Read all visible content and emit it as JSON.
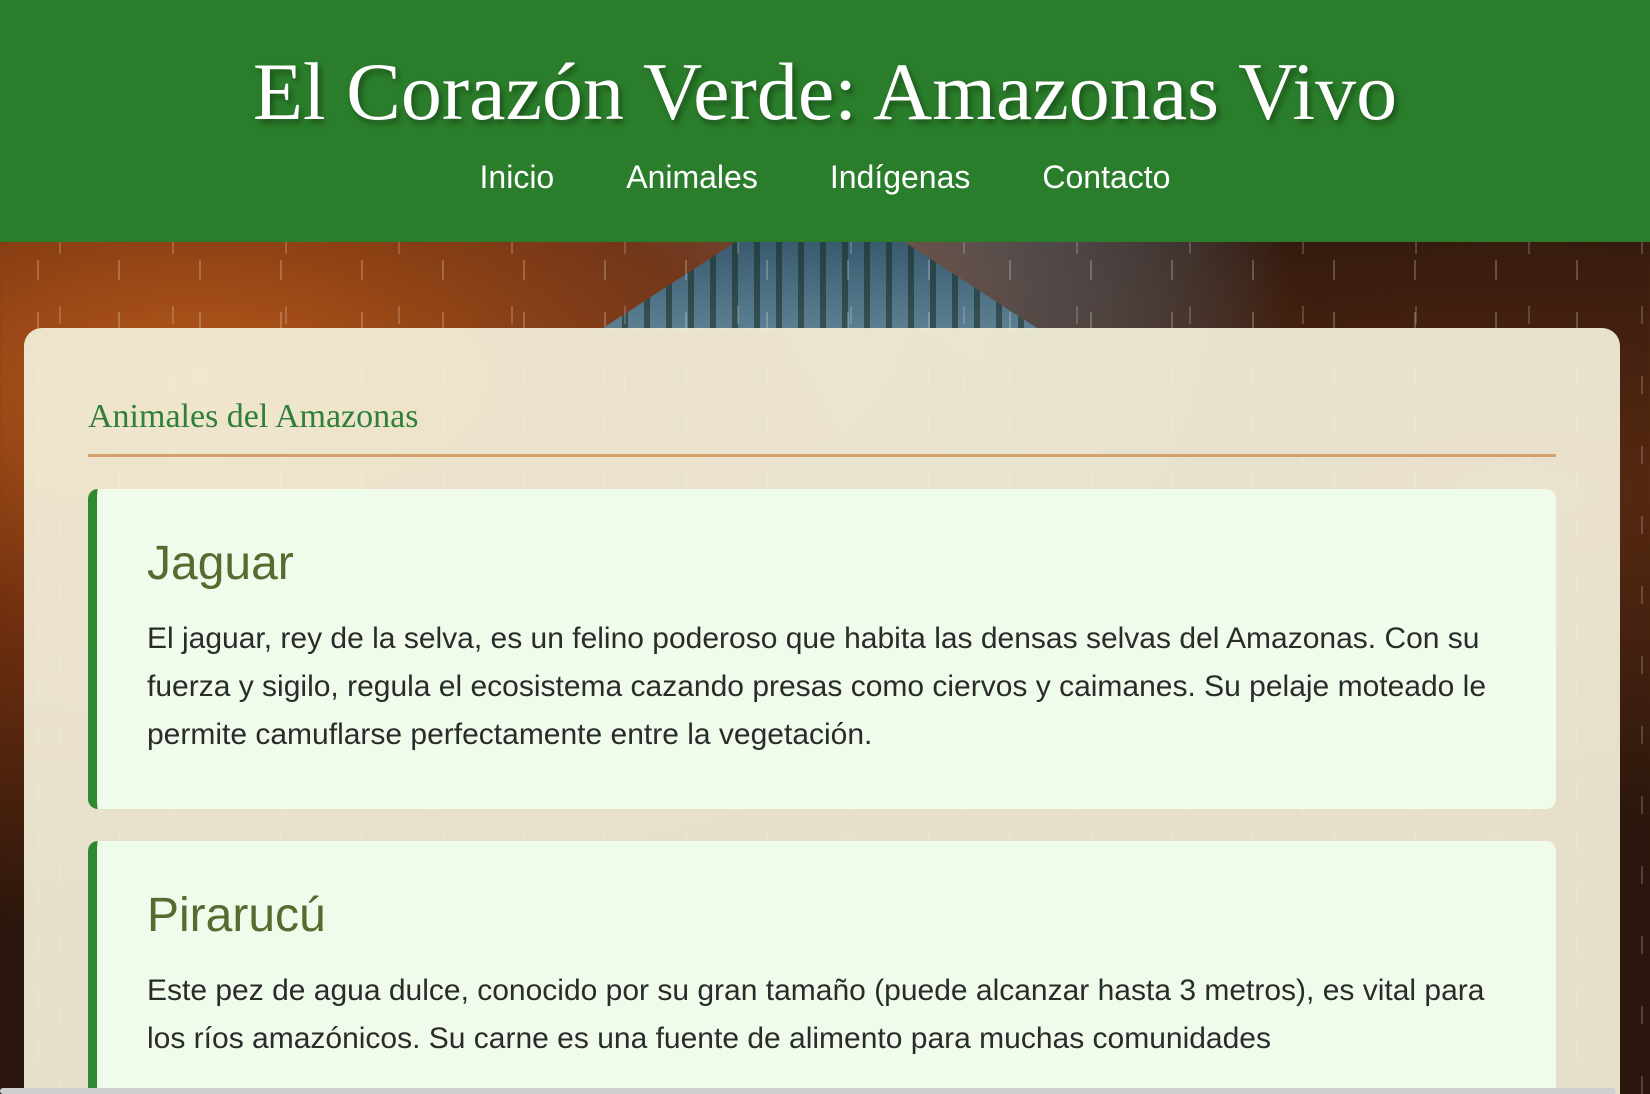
{
  "header": {
    "title": "El Corazón Verde: Amazonas Vivo",
    "nav": [
      {
        "label": "Inicio"
      },
      {
        "label": "Animales"
      },
      {
        "label": "Indígenas"
      },
      {
        "label": "Contacto"
      }
    ],
    "background_color": "#2a7d2a"
  },
  "main": {
    "section_title": "Animales del Amazonas",
    "cards": [
      {
        "name": "Jaguar",
        "description": "El jaguar, rey de la selva, es un felino poderoso que habita las densas selvas del Amazonas. Con su fuerza y sigilo, regula el ecosistema cazando presas como ciervos y caimanes. Su pelaje moteado le permite camuflarse perfectamente entre la vegetación."
      },
      {
        "name": "Pirarucú",
        "description": "Este pez de agua dulce, conocido por su gran tamaño (puede alcanzar hasta 3 metros), es vital para los ríos amazónicos. Su carne es una fuente de alimento para muchas comunidades"
      }
    ]
  },
  "colors": {
    "accent_green": "#2e8a32",
    "divider_tan": "#d4a06b",
    "card_bg": "#effbeb"
  }
}
